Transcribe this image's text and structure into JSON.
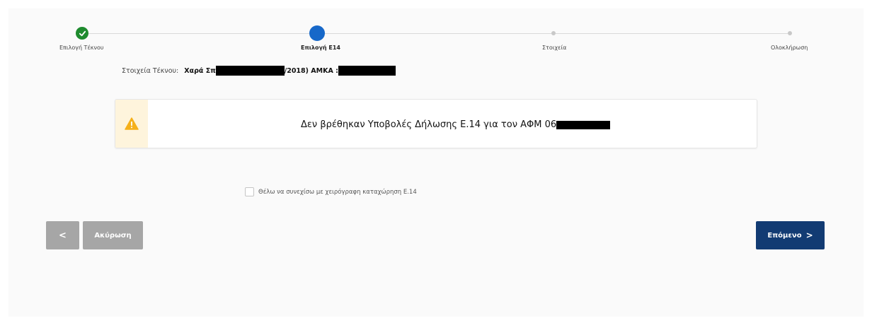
{
  "stepper": {
    "steps": [
      {
        "label": "Επιλογή Τέκνου",
        "state": "done"
      },
      {
        "label": "Επιλογή Ε14",
        "state": "active"
      },
      {
        "label": "Στοιχεία",
        "state": "pending"
      },
      {
        "label": "Ολοκλήρωση",
        "state": "pending"
      }
    ]
  },
  "child_info": {
    "label": "Στοιχεία Τέκνου:",
    "name_prefix": "Χαρά Σπ",
    "name_suffix": "/2018) ΑΜΚΑ :"
  },
  "alert": {
    "icon": "warning-icon",
    "message": "Δεν βρέθηκαν Υποβολές Δήλωσης Ε.14 για τον ΑΦΜ 06"
  },
  "manual_entry": {
    "label": "Θέλω να συνεχίσω με χειρόγραφη καταχώρηση Ε.14",
    "checked": false
  },
  "buttons": {
    "back_icon": "chevron-left-icon",
    "back_glyph": "<",
    "cancel_label": "Ακύρωση",
    "next_label": "Επόμενο",
    "next_glyph": ">"
  },
  "colors": {
    "done": "#1e8b2e",
    "active": "#1768c9",
    "primary_button": "#123b73",
    "disabled_button": "#a6a6a6",
    "warning": "#f5b01a"
  }
}
